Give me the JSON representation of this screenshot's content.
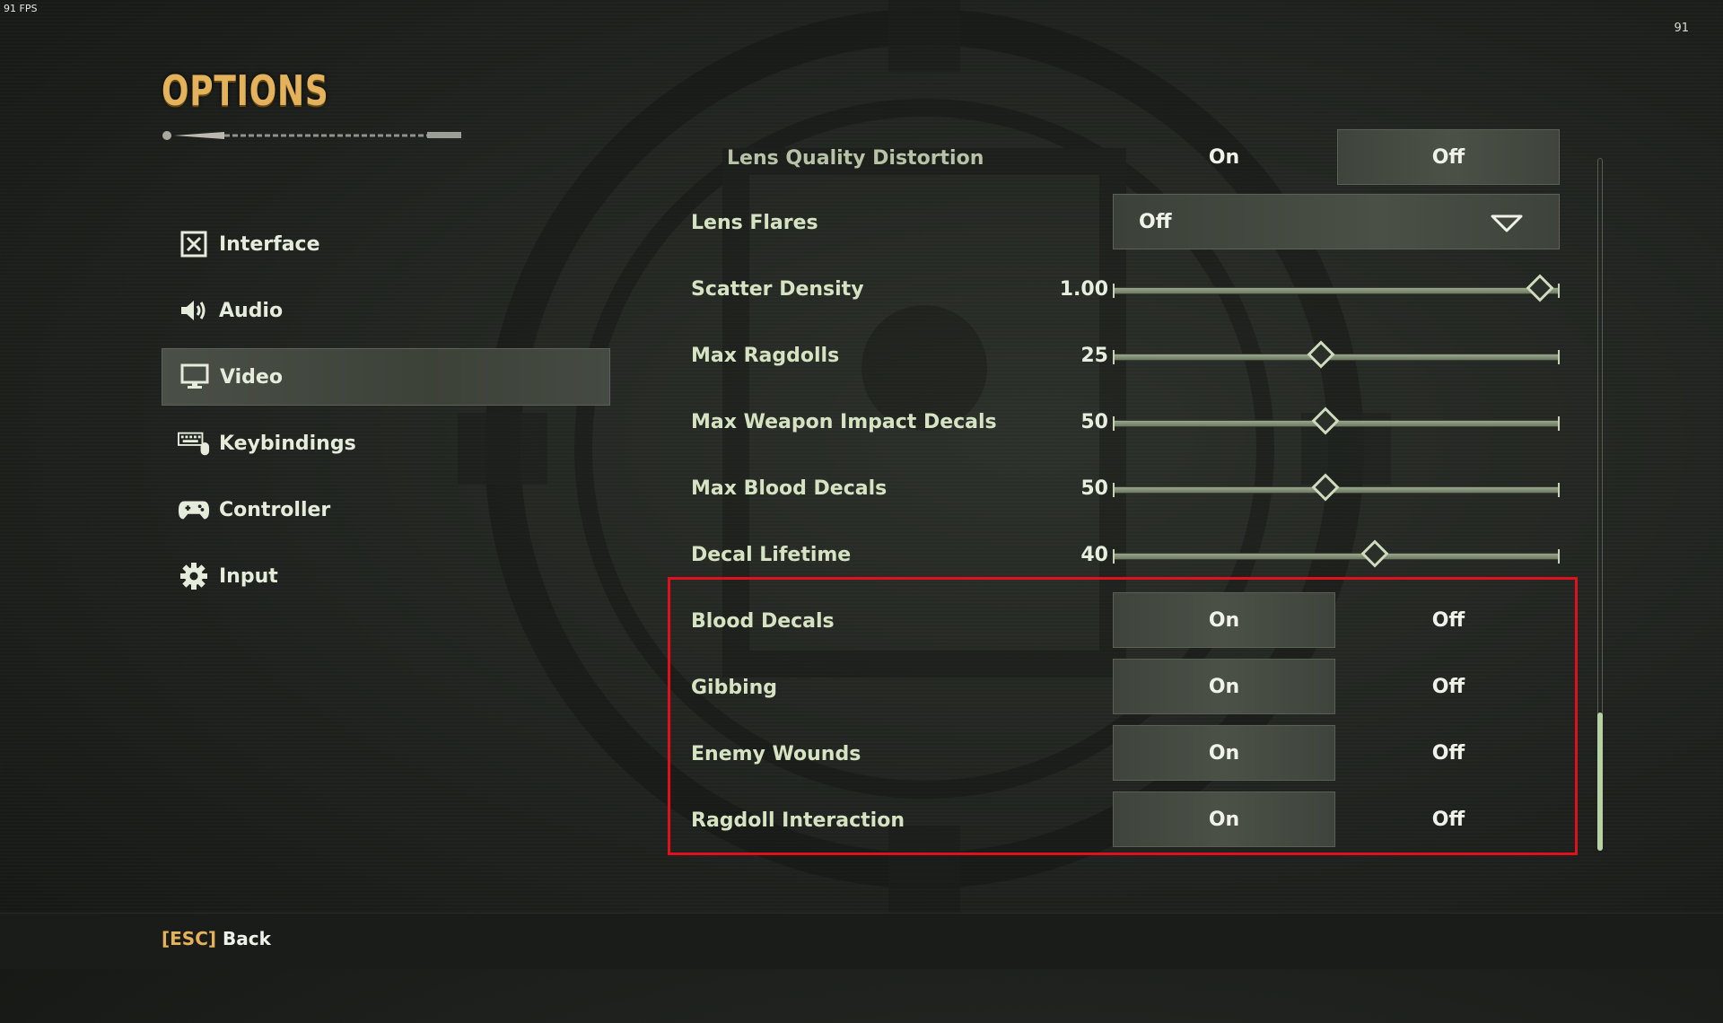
{
  "hud": {
    "fps": "91 FPS",
    "counter": "91"
  },
  "page": {
    "title": "OPTIONS"
  },
  "nav": {
    "items": [
      {
        "label": "Interface",
        "icon": "interface-icon",
        "active": false
      },
      {
        "label": "Audio",
        "icon": "speaker-icon",
        "active": false
      },
      {
        "label": "Video",
        "icon": "monitor-icon",
        "active": true
      },
      {
        "label": "Keybindings",
        "icon": "keyboard-mouse-icon",
        "active": false
      },
      {
        "label": "Controller",
        "icon": "gamepad-icon",
        "active": false
      },
      {
        "label": "Input",
        "icon": "gear-icon",
        "active": false
      }
    ]
  },
  "settings": {
    "lens_quality_distortion": {
      "label": "Lens Quality Distortion",
      "on": "On",
      "off": "Off",
      "selected": "Off"
    },
    "lens_flares": {
      "label": "Lens Flares",
      "value": "Off"
    },
    "scatter_density": {
      "label": "Scatter Density",
      "value": "1.00",
      "fraction": 0.96
    },
    "max_ragdolls": {
      "label": "Max Ragdolls",
      "value": "25",
      "fraction": 0.47
    },
    "max_weapon_impact_decals": {
      "label": "Max Weapon Impact Decals",
      "value": "50",
      "fraction": 0.48
    },
    "max_blood_decals": {
      "label": "Max Blood Decals",
      "value": "50",
      "fraction": 0.48
    },
    "decal_lifetime": {
      "label": "Decal Lifetime",
      "value": "40",
      "fraction": 0.59
    },
    "blood_decals": {
      "label": "Blood Decals",
      "on": "On",
      "off": "Off",
      "selected": "On"
    },
    "gibbing": {
      "label": "Gibbing",
      "on": "On",
      "off": "Off",
      "selected": "On"
    },
    "enemy_wounds": {
      "label": "Enemy Wounds",
      "on": "On",
      "off": "Off",
      "selected": "On"
    },
    "ragdoll_interaction": {
      "label": "Ragdoll Interaction",
      "on": "On",
      "off": "Off",
      "selected": "On"
    }
  },
  "scroll": {
    "position_fraction": 0.8
  },
  "footer": {
    "key": "[ESC]",
    "label": "Back"
  },
  "colors": {
    "accent_gold": "#e3b25a",
    "highlight_red": "#e0111c",
    "text": "#d6e3c2"
  }
}
